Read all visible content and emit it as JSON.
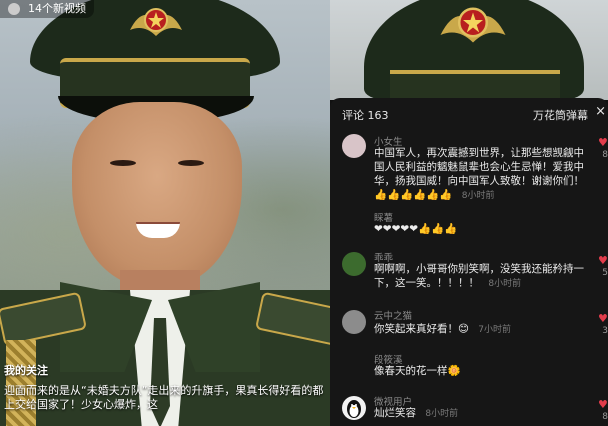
{
  "video": {
    "top_chip": "14个新视频",
    "my_follow": "我的关注",
    "caption": "迎面而来的是从“未婚夫方队”走出来的升旗手，果真长得好看的都上交给国家了！少女心爆炸，这"
  },
  "comments_panel": {
    "count_label": "评论 163",
    "danmu_label": "万花筒弹幕",
    "close": "×",
    "comments": [
      {
        "name": "小女生",
        "text": "中国军人，再次震撼到世界，让那些想觊觎中国人民利益的魑魅鼠辈也会心生忌惮！爱我中华，扬我国威！向中国军人致敬！谢谢你们！",
        "emoji_line": "👍👍👍👍👍👍",
        "time": "8小时前",
        "avatar_color": "#d8c4c8",
        "likes": "8"
      },
      {
        "name": "睬薯",
        "emoji_line": "❤❤❤❤❤👍👍👍",
        "time": "",
        "avatar_color": "",
        "likes": ""
      },
      {
        "name": "乖乖",
        "text": "啊啊啊，小哥哥你别笑啊，没笑我还能矜持一下，这一笑。！！！！",
        "time": "8小时前",
        "avatar_color": "#3c6b2e",
        "likes": "5"
      },
      {
        "name": "云中之猫",
        "text": "你笑起来真好看！😊",
        "time": "7小时前",
        "avatar_color": "#8c8c8c",
        "likes": "3"
      },
      {
        "name": "段筱溪",
        "text": "像春天的花一样🌼",
        "time": "",
        "avatar_color": "",
        "likes": ""
      },
      {
        "name": "微视用户",
        "text": "灿烂笑容",
        "time": "8小时前",
        "avatar_color": "#f2f2f2",
        "likes": "8"
      }
    ]
  },
  "colors": {
    "panel_bg": "#161616",
    "heart": "#e23c4b",
    "gold": "#c9a84a"
  }
}
